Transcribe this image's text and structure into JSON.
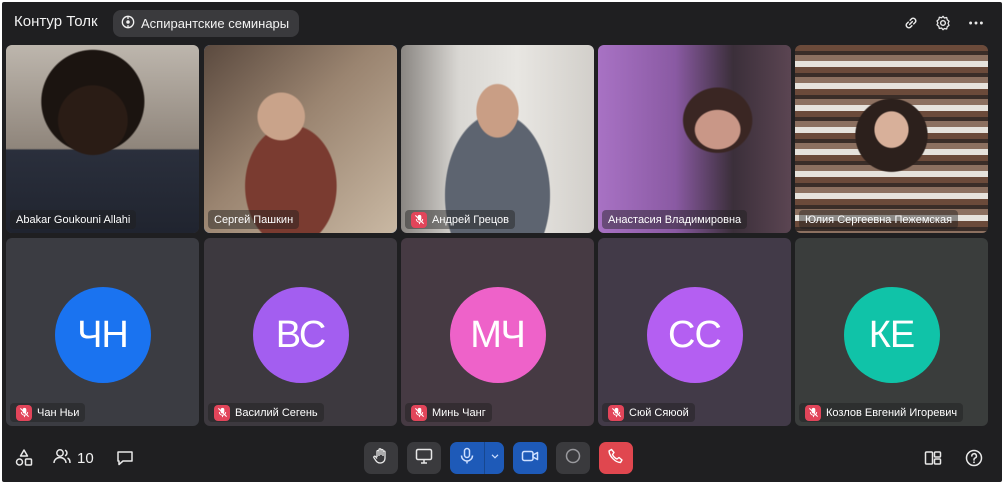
{
  "header": {
    "app_title": "Контур Толк",
    "meeting_name": "Аспирантские семинары",
    "icons": [
      "link-icon",
      "gear-icon",
      "more-icon"
    ]
  },
  "participants_video": [
    {
      "name": "Abakar Goukouni Allahi",
      "muted": false,
      "active": false,
      "tint": "#6f5a4c"
    },
    {
      "name": "Сергей Пашкин",
      "muted": false,
      "active": true,
      "tint": "#8a6f58"
    },
    {
      "name": "Андрей Грецов",
      "muted": true,
      "active": false,
      "tint": "#a9a6a0"
    },
    {
      "name": "Анастасия Владимировна",
      "muted": false,
      "active": false,
      "tint": "#7d5a86"
    },
    {
      "name": "Юлия Сергеевна Пежемская",
      "muted": false,
      "active": false,
      "tint": "#5b5148"
    }
  ],
  "participants_avatar": [
    {
      "initials": "ЧН",
      "name": "Чан Ньи",
      "muted": true,
      "color": "#1a73f0",
      "bg": "#3b3c42"
    },
    {
      "initials": "ВС",
      "name": "Василий Сегень",
      "muted": true,
      "color": "#a35ef0",
      "bg": "#3d393f"
    },
    {
      "initials": "МЧ",
      "name": "Минь Чанг",
      "muted": true,
      "color": "#ee62c9",
      "bg": "#463a43"
    },
    {
      "initials": "СС",
      "name": "Сюй Сяюой",
      "muted": true,
      "color": "#b45ff2",
      "bg": "#423a48"
    },
    {
      "initials": "КЕ",
      "name": "Козлов Евгений Игоревич",
      "muted": true,
      "color": "#10c3a8",
      "bg": "#3a3d3c"
    }
  ],
  "toolbar": {
    "participants_count": "10",
    "colors": {
      "mic": "#1e5ab8",
      "camera": "#1e5ab8",
      "leave": "#e0474f",
      "neutral": "#3a3a3d"
    }
  }
}
